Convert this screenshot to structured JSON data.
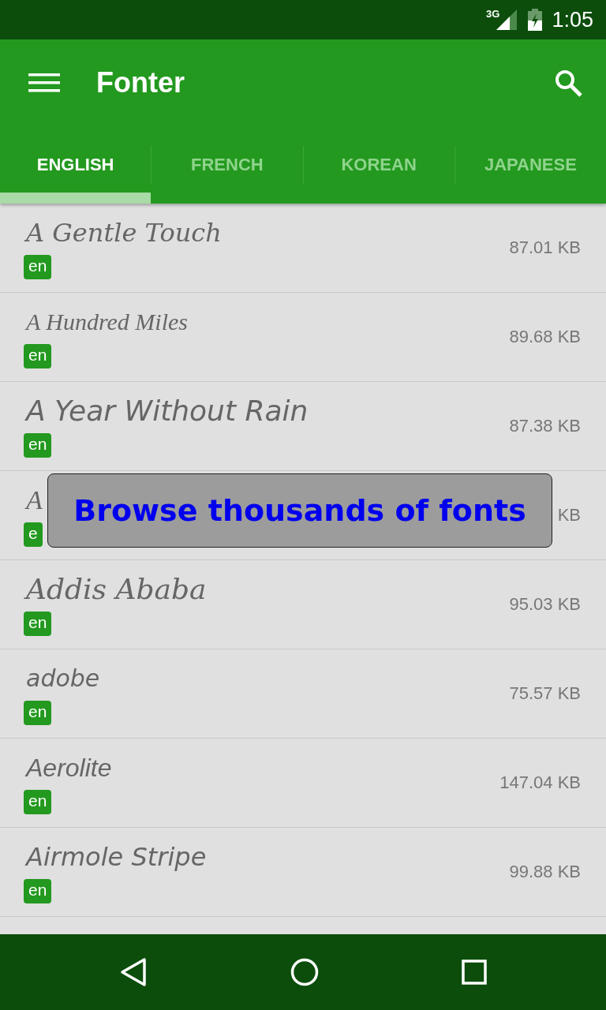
{
  "status_bar": {
    "network": "3G",
    "time": "1:05"
  },
  "app_bar": {
    "title": "Fonter"
  },
  "tabs": [
    {
      "label": "ENGLISH",
      "selected": true
    },
    {
      "label": "FRENCH",
      "selected": false
    },
    {
      "label": "KOREAN",
      "selected": false
    },
    {
      "label": "JAPANESE",
      "selected": false
    }
  ],
  "fonts": [
    {
      "name": "A Gentle Touch",
      "language": "en",
      "size": "87.01 KB"
    },
    {
      "name": "A Hundred Miles",
      "language": "en",
      "size": "89.68 KB"
    },
    {
      "name": "A Year Without Rain",
      "language": "en",
      "size": "87.38 KB"
    },
    {
      "name": "A",
      "language": "e",
      "size": "KB"
    },
    {
      "name": "Addis Ababa",
      "language": "en",
      "size": "95.03 KB"
    },
    {
      "name": "adobe",
      "language": "en",
      "size": "75.57 KB"
    },
    {
      "name": "Aerolite",
      "language": "en",
      "size": "147.04 KB"
    },
    {
      "name": "Airmole Stripe",
      "language": "en",
      "size": "99.88 KB"
    }
  ],
  "banner": {
    "text": "Browse thousands of fonts"
  }
}
